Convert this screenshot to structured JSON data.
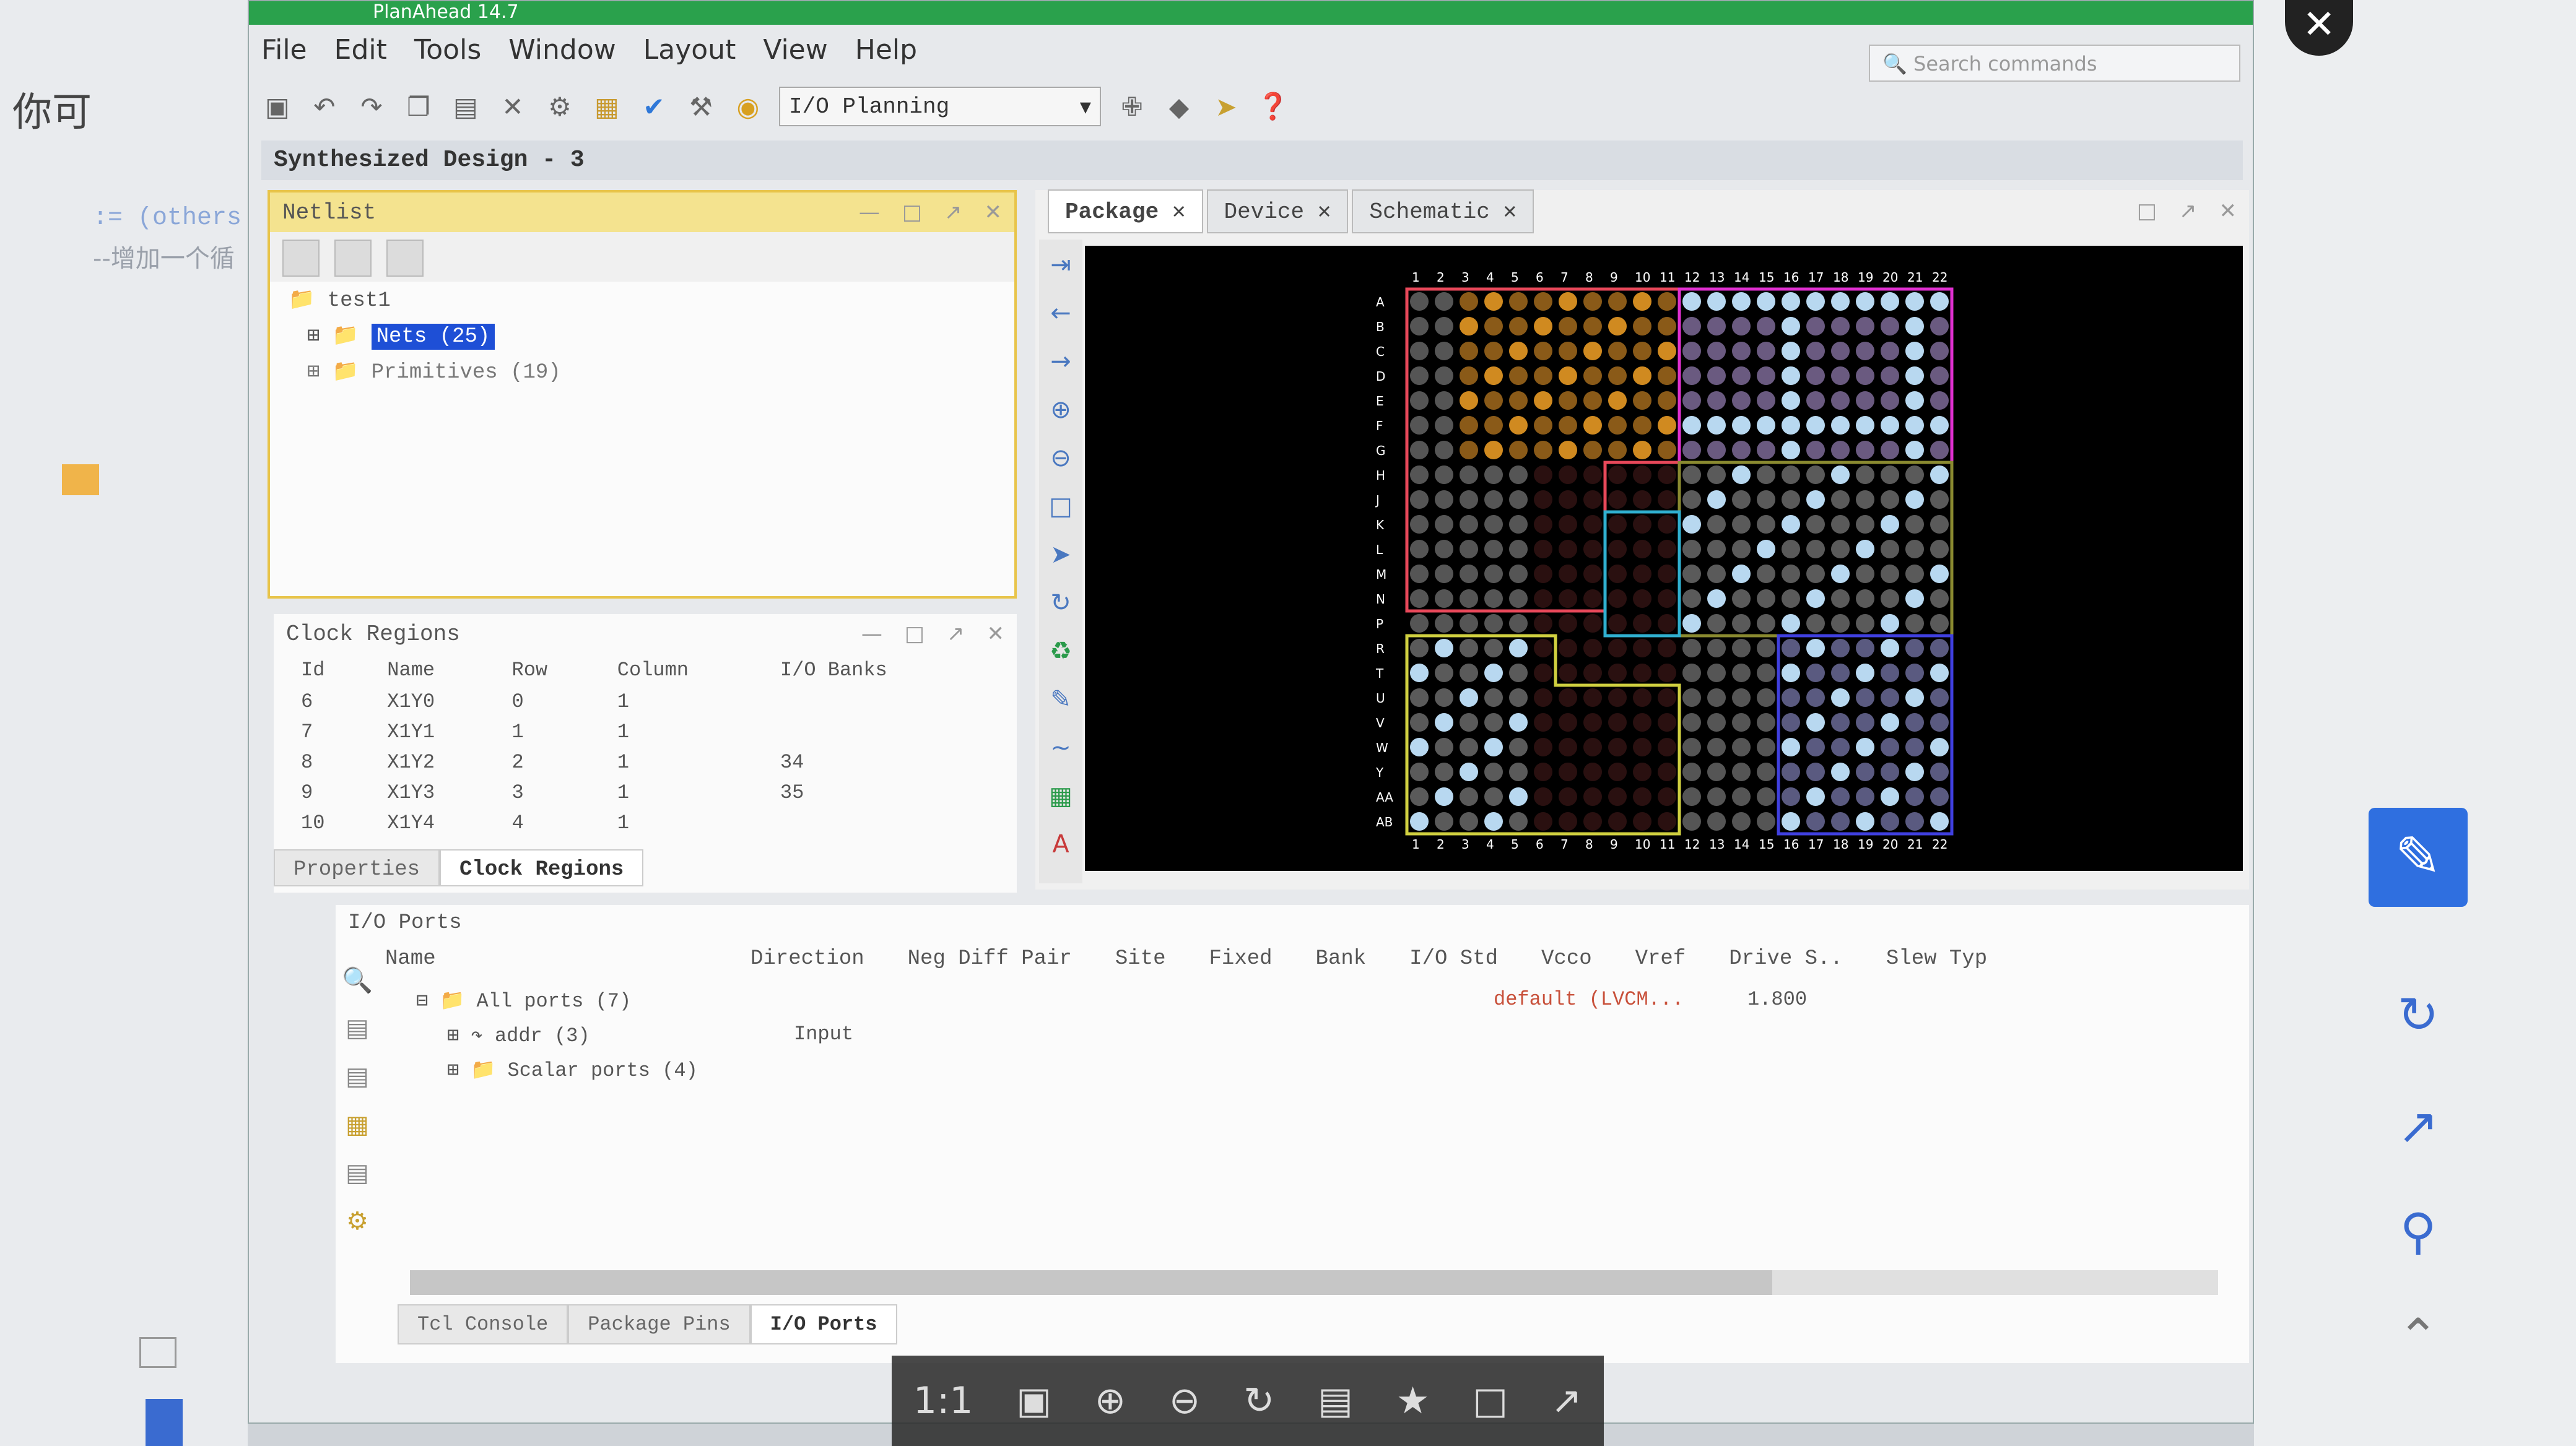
{
  "window": {
    "title": "PlanAhead 14.7",
    "menu": [
      "File",
      "Edit",
      "Tools",
      "Window",
      "Layout",
      "View",
      "Help"
    ],
    "search_placeholder": "Search commands",
    "layout_select": "I/O Planning"
  },
  "design": {
    "title": "Synthesized Design - 3"
  },
  "netlist": {
    "title": "Netlist",
    "root": "test1",
    "nets": "Nets (25)",
    "primitives": "Primitives (19)"
  },
  "clock_regions": {
    "title": "Clock Regions",
    "headers": [
      "Id",
      "Name",
      "Row",
      "Column",
      "I/O Banks"
    ],
    "rows": [
      [
        "6",
        "X1Y0",
        "0",
        "1",
        ""
      ],
      [
        "7",
        "X1Y1",
        "1",
        "1",
        ""
      ],
      [
        "8",
        "X1Y2",
        "2",
        "1",
        "34"
      ],
      [
        "9",
        "X1Y3",
        "3",
        "1",
        "35"
      ],
      [
        "10",
        "X1Y4",
        "4",
        "1",
        ""
      ]
    ],
    "tabs": [
      "Properties",
      "Clock Regions"
    ]
  },
  "package": {
    "tabs": [
      "Package",
      "Device",
      "Schematic"
    ],
    "cols": [
      "1",
      "2",
      "3",
      "4",
      "5",
      "6",
      "7",
      "8",
      "9",
      "10",
      "11",
      "12",
      "13",
      "14",
      "15",
      "16",
      "17",
      "18",
      "19",
      "20",
      "21",
      "22"
    ],
    "rows": [
      "A",
      "B",
      "C",
      "D",
      "E",
      "F",
      "G",
      "H",
      "J",
      "K",
      "L",
      "M",
      "N",
      "P",
      "R",
      "T",
      "U",
      "V",
      "W",
      "Y",
      "AA",
      "AB"
    ]
  },
  "io_ports": {
    "title": "I/O Ports",
    "headers": [
      "Name",
      "Direction",
      "Neg Diff Pair",
      "Site",
      "Fixed",
      "Bank",
      "I/O Std",
      "Vcco",
      "Vref",
      "Drive S..",
      "Slew Typ"
    ],
    "all_ports": "All ports (7)",
    "addr": "addr (3)",
    "addr_dir": "Input",
    "scalar": "Scalar ports (4)",
    "iostd": "default (LVCM...",
    "vcco": "1.800",
    "tabs": [
      "Tcl Console",
      "Package Pins",
      "I/O Ports"
    ]
  },
  "viewer": {
    "zoom_label": "1:1"
  },
  "bg": {
    "left_char": "你可",
    "code1": ":= (others",
    "code2": "--增加一个循"
  }
}
